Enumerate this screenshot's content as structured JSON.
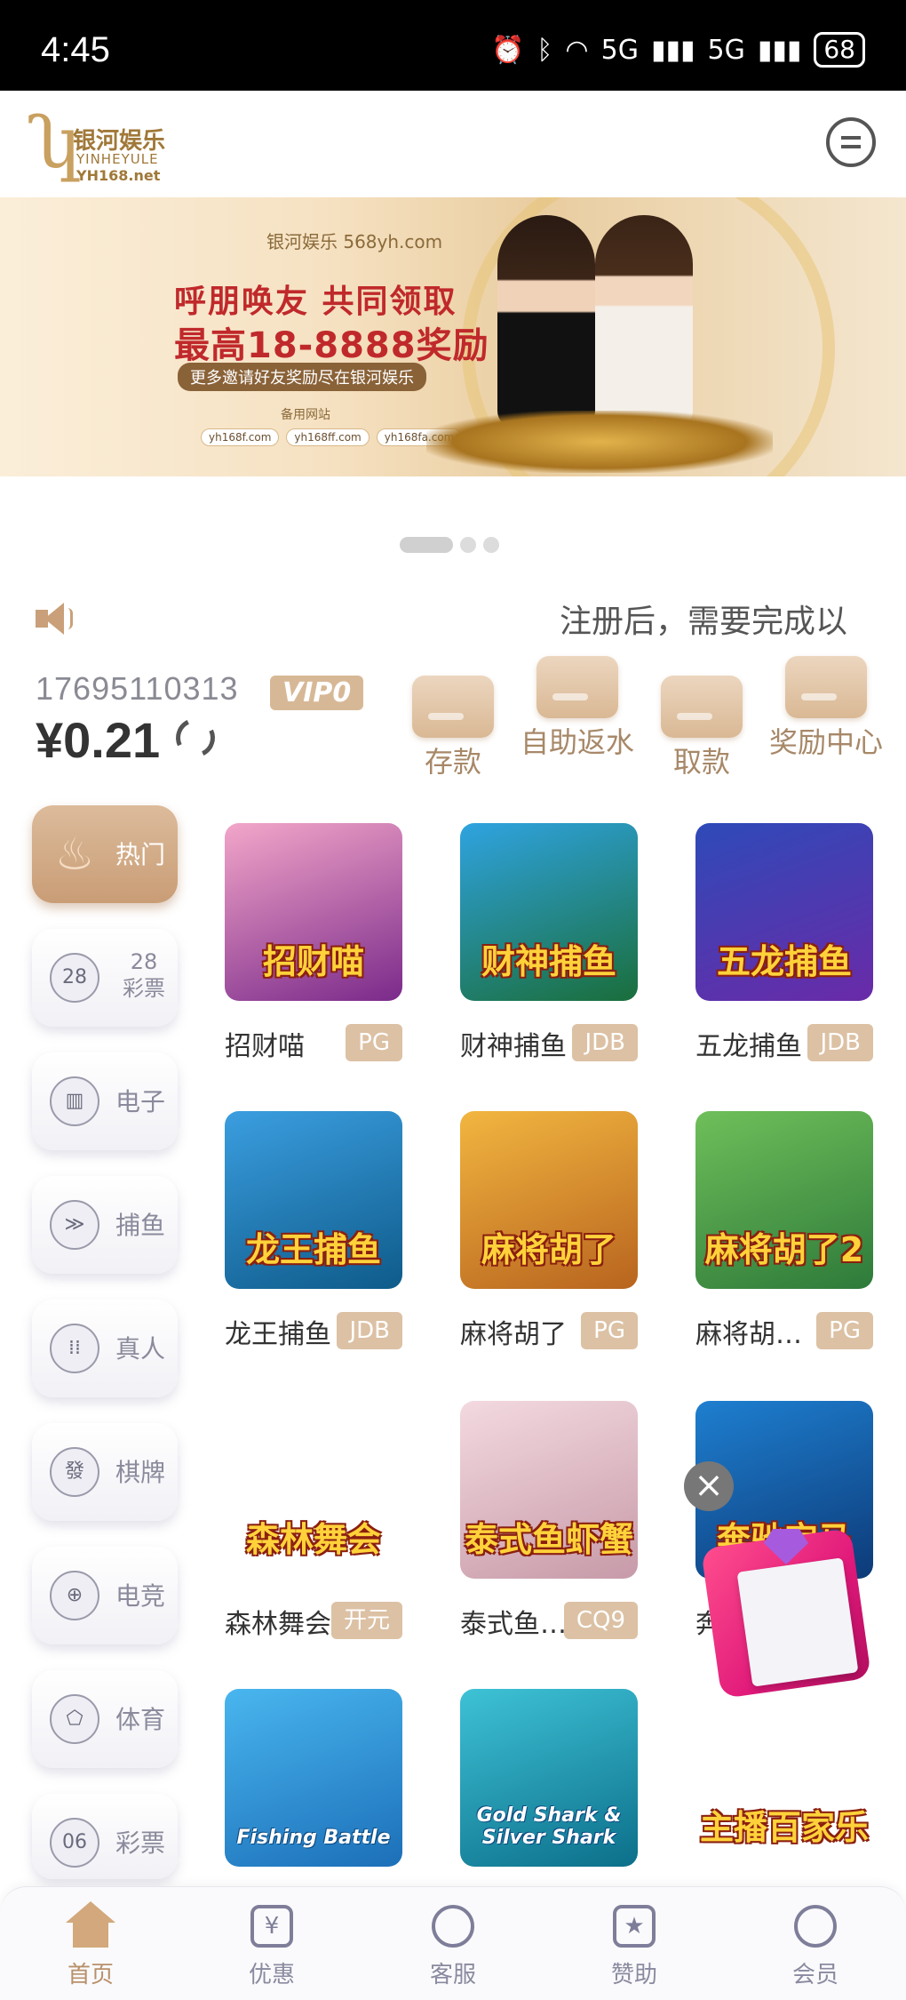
{
  "status_bar": {
    "time": "4:45",
    "battery": "68",
    "network": "5G"
  },
  "header": {
    "logo_cn": "银河娱乐",
    "logo_en": "YINHEYULE",
    "logo_url": "YH168.net",
    "chat_icon": "chat-bubble-icon"
  },
  "banner": {
    "logo": "银河娱乐 568yh.com",
    "line1": "呼朋唤友 共同领取",
    "line2": "最高18-8888奖励",
    "line3": "更多邀请好友奖励尽在银河娱乐",
    "line4": "备用网站",
    "urls": [
      "yh168f.com",
      "yh168ff.com",
      "yh168fa.com"
    ],
    "page_count": 3,
    "active_page": 0
  },
  "marquee": {
    "text": "注册后，需要完成以"
  },
  "account": {
    "phone": "17695110313",
    "vip": "VIP0",
    "balance": "¥0.21"
  },
  "actions": [
    {
      "label": "存款"
    },
    {
      "label": "自助返水"
    },
    {
      "label": "取款"
    },
    {
      "label": "奖励中心"
    }
  ],
  "categories": [
    {
      "label": "热门",
      "icon": "flame-icon",
      "active": true
    },
    {
      "label": "28 彩票",
      "icon": "lottery-28-icon"
    },
    {
      "label": "电子",
      "icon": "slot-machine-icon"
    },
    {
      "label": "捕鱼",
      "icon": "fish-icon"
    },
    {
      "label": "真人",
      "icon": "dice-icon"
    },
    {
      "label": "棋牌",
      "icon": "mahjong-tile-icon",
      "glyph": "發"
    },
    {
      "label": "电竞",
      "icon": "gamepad-icon"
    },
    {
      "label": "体育",
      "icon": "soccer-ball-icon"
    },
    {
      "label": "彩票",
      "icon": "lottery-ball-icon",
      "glyph": "06"
    }
  ],
  "games": [
    {
      "name": "招财喵",
      "provider": "PG",
      "art": "招财喵",
      "colors": [
        "#f3a6c9",
        "#7a2a8a"
      ]
    },
    {
      "name": "财神捕鱼",
      "provider": "JDB",
      "art": "财神捕鱼",
      "colors": [
        "#2fa3e0",
        "#1a6e3b"
      ]
    },
    {
      "name": "五龙捕鱼",
      "provider": "JDB",
      "art": "五龙捕鱼",
      "colors": [
        "#2e4ab8",
        "#6a2aa8"
      ]
    },
    {
      "name": "龙王捕鱼",
      "provider": "JDB",
      "art": "龙王捕鱼",
      "colors": [
        "#3b9ee0",
        "#0e5b8a"
      ]
    },
    {
      "name": "麻将胡了",
      "provider": "PG",
      "art": "麻将胡了",
      "colors": [
        "#f2b640",
        "#b8641e"
      ]
    },
    {
      "name": "麻将胡…",
      "provider": "PG",
      "art": "麻将胡了2",
      "colors": [
        "#6fbf5a",
        "#2e7a3a"
      ]
    },
    {
      "name": "森林舞会",
      "provider": "开元",
      "art": "森林舞会",
      "colors": [
        "#ffffff",
        "#ffffff"
      ]
    },
    {
      "name": "泰式鱼…",
      "provider": "CQ9",
      "art": "泰式鱼虾蟹",
      "colors": [
        "#f3d9e0",
        "#c79aa8"
      ]
    },
    {
      "name": "奔",
      "provider": "",
      "art": "奔驰宝马",
      "colors": [
        "#1e7fd0",
        "#0d3a78"
      ]
    },
    {
      "name": "",
      "provider": "",
      "art": "Fishing Battle",
      "colors": [
        "#49b6ef",
        "#1c6fb8"
      ]
    },
    {
      "name": "",
      "provider": "",
      "art": "Gold Shark & Silver Shark",
      "colors": [
        "#3ec2d6",
        "#0c6f8a"
      ]
    },
    {
      "name": "",
      "provider": "",
      "art": "主播百家乐",
      "colors": [
        "#ffffff",
        "#ffffff"
      ]
    }
  ],
  "floating_promo": {
    "close_icon": "close-icon",
    "gift_icon": "gift-box-icon"
  },
  "bottom_nav": [
    {
      "label": "首页",
      "icon": "home-icon",
      "active": true
    },
    {
      "label": "优惠",
      "icon": "ticket-icon",
      "glyph": "¥"
    },
    {
      "label": "客服",
      "icon": "headset-icon"
    },
    {
      "label": "赞助",
      "icon": "bookmark-star-icon",
      "glyph": "★"
    },
    {
      "label": "会员",
      "icon": "user-icon"
    }
  ]
}
